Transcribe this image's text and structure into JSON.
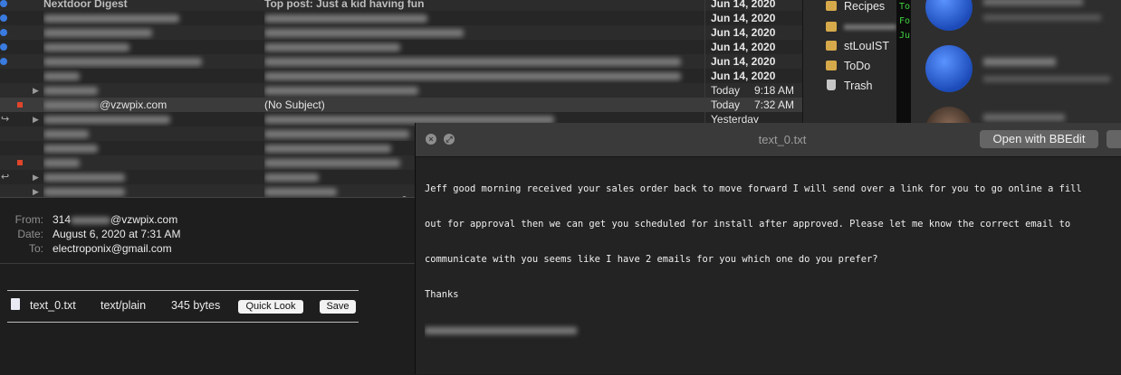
{
  "message_list": {
    "rows": [
      {
        "from": "Nextdoor Digest",
        "subject": "Top post: Just a kid having fun",
        "date": "Jun 14, 2020",
        "time": "",
        "unread": true,
        "date_bold": true
      },
      {
        "from": "",
        "subject": "",
        "date": "Jun 14, 2020",
        "time": "",
        "unread": true,
        "date_bold": true
      },
      {
        "from": "",
        "subject": "",
        "date": "Jun 14, 2020",
        "time": "",
        "unread": true,
        "date_bold": true
      },
      {
        "from": "",
        "subject": "",
        "date": "Jun 14, 2020",
        "time": "",
        "unread": true,
        "date_bold": true
      },
      {
        "from": "",
        "subject": "",
        "date": "Jun 14, 2020",
        "time": "",
        "unread": true,
        "date_bold": true
      },
      {
        "from": "",
        "subject": "",
        "date": "Jun 14, 2020",
        "time": "",
        "unread": false,
        "date_bold": true
      },
      {
        "from": "",
        "subject": "",
        "date": "Today",
        "time": "9:18 AM",
        "unread": false,
        "date_bold": false
      },
      {
        "from": "@vzwpix.com",
        "subject": "(No Subject)",
        "date": "Today",
        "time": "7:32 AM",
        "unread": false,
        "date_bold": false
      },
      {
        "from": "",
        "subject": "",
        "date": "Yesterday",
        "time": "",
        "unread": false,
        "date_bold": false
      }
    ]
  },
  "mailboxes": {
    "items": [
      {
        "label": "Recipes",
        "icon": "folder-icon"
      },
      {
        "label": "",
        "icon": "folder-icon"
      },
      {
        "label": "stLouIST",
        "icon": "folder-icon"
      },
      {
        "label": "ToDo",
        "icon": "folder-icon"
      },
      {
        "label": "Trash",
        "icon": "trash-icon"
      }
    ]
  },
  "terminal": {
    "lines": [
      "To",
      "Fo",
      "Ju"
    ]
  },
  "header": {
    "from_label": "From:",
    "from_value_prefix": "314",
    "from_value_suffix": "@vzwpix.com",
    "date_label": "Date:",
    "date_value": "August 6, 2020 at 7:31 AM",
    "to_label": "To:",
    "to_value": "electroponix@gmail.com"
  },
  "attachment": {
    "filename": "text_0.txt",
    "mime": "text/plain",
    "size": "345 bytes",
    "quicklook_label": "Quick Look",
    "save_label": "Save"
  },
  "quicklook": {
    "title": "text_0.txt",
    "open_with_label": "Open with BBEdit",
    "body_lines": [
      "Jeff good morning received your sales order back to move forward I will send over a link for you to go online a fill",
      "out for approval then we can get you scheduled for install after approved. Please let me know the correct email to",
      "communicate with you seems like I have 2 emails for you which one do you prefer?",
      "Thanks"
    ]
  },
  "colors": {
    "unread_dot": "#3a7be0",
    "flag": "#e0452b",
    "terminal_text": "#3fd13f"
  }
}
